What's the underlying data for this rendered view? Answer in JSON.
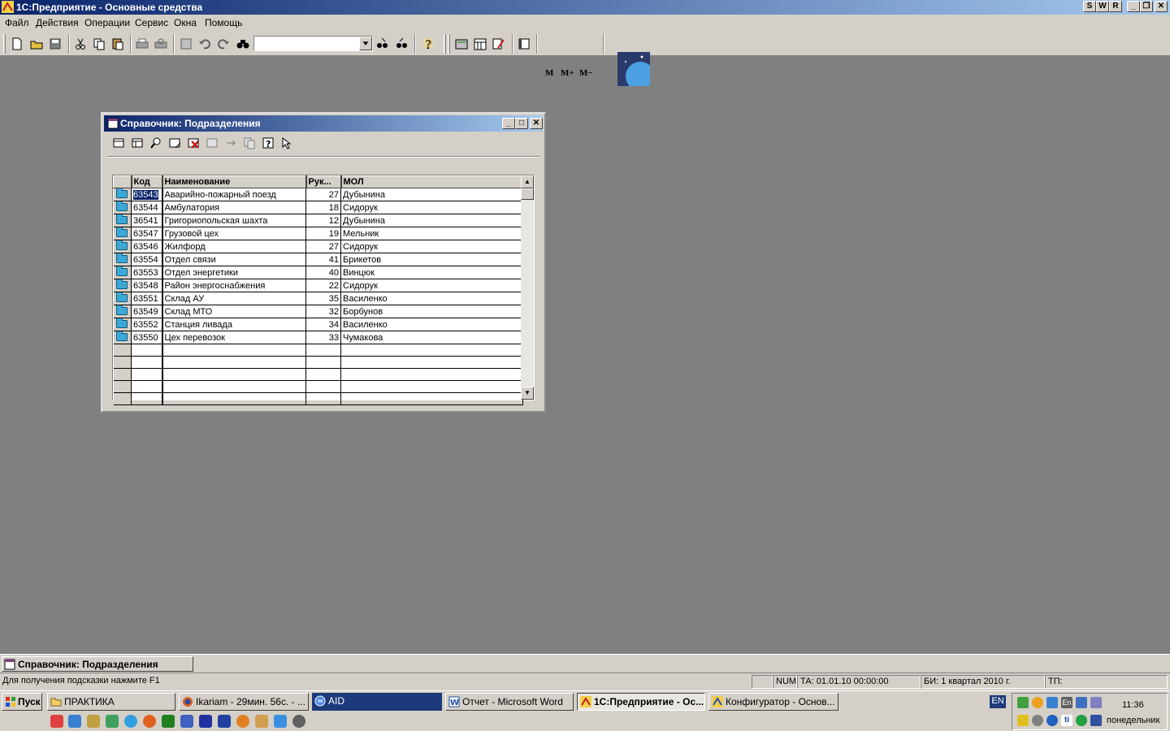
{
  "app": {
    "title": "1С:Предприятие - Основные средства",
    "title_buttons": [
      "S",
      "W",
      "R"
    ]
  },
  "menu": [
    "Файл",
    "Действия",
    "Операции",
    "Сервис",
    "Окна",
    "Помощь"
  ],
  "toolbar": {
    "search_value": "",
    "memory_buttons": [
      "M",
      "M+",
      "M−"
    ]
  },
  "child_window": {
    "title": "Справочник: Подразделения",
    "columns": [
      "Код",
      "Наименование",
      "Рук...",
      "МОЛ"
    ],
    "rows": [
      {
        "code": "63543",
        "name": "Аварийно-пожарный поезд",
        "head": "27",
        "mol": "Дубынина"
      },
      {
        "code": "63544",
        "name": "Амбулатория",
        "head": "18",
        "mol": "Сидорук"
      },
      {
        "code": "36541",
        "name": "Григориопольская шахта",
        "head": "12",
        "mol": "Дубынина"
      },
      {
        "code": "63547",
        "name": "Грузовой цех",
        "head": "19",
        "mol": "Мельник"
      },
      {
        "code": "63546",
        "name": "Жилфорд",
        "head": "27",
        "mol": "Сидорук"
      },
      {
        "code": "63554",
        "name": "Отдел связи",
        "head": "41",
        "mol": "Брикетов"
      },
      {
        "code": "63553",
        "name": "Отдел энергетики",
        "head": "40",
        "mol": "Винцюк"
      },
      {
        "code": "63548",
        "name": "Район энергоснабжения",
        "head": "22",
        "mol": "Сидорук"
      },
      {
        "code": "63551",
        "name": "Склад АУ",
        "head": "35",
        "mol": "Василенко"
      },
      {
        "code": "63549",
        "name": "Склад МТО",
        "head": "32",
        "mol": "Борбунов"
      },
      {
        "code": "63552",
        "name": "Станция ливада",
        "head": "34",
        "mol": "Василенко"
      },
      {
        "code": "63550",
        "name": "Цех перевозок",
        "head": "33",
        "mol": "Чумакова"
      }
    ]
  },
  "window_tab": "Справочник: Подразделения",
  "status": {
    "hint": "Для получения подсказки нажмите F1",
    "num": "NUM",
    "ta": "ТА: 01.01.10  00:00:00",
    "bi": "БИ: 1 квартал 2010 г.",
    "tp": "ТП:"
  },
  "taskbar": {
    "start": "Пуск",
    "tasks": [
      "ПРАКТИКА",
      "Ikariam - 29мин. 56с. - ...",
      "AID",
      "Отчет - Microsoft Word",
      "1С:Предприятие - Ос...",
      "Конфигуратор - Основ..."
    ],
    "lang": "EN",
    "time": "11:36",
    "day": "понедельник",
    "tray_text": [
      "En",
      "ti"
    ]
  }
}
